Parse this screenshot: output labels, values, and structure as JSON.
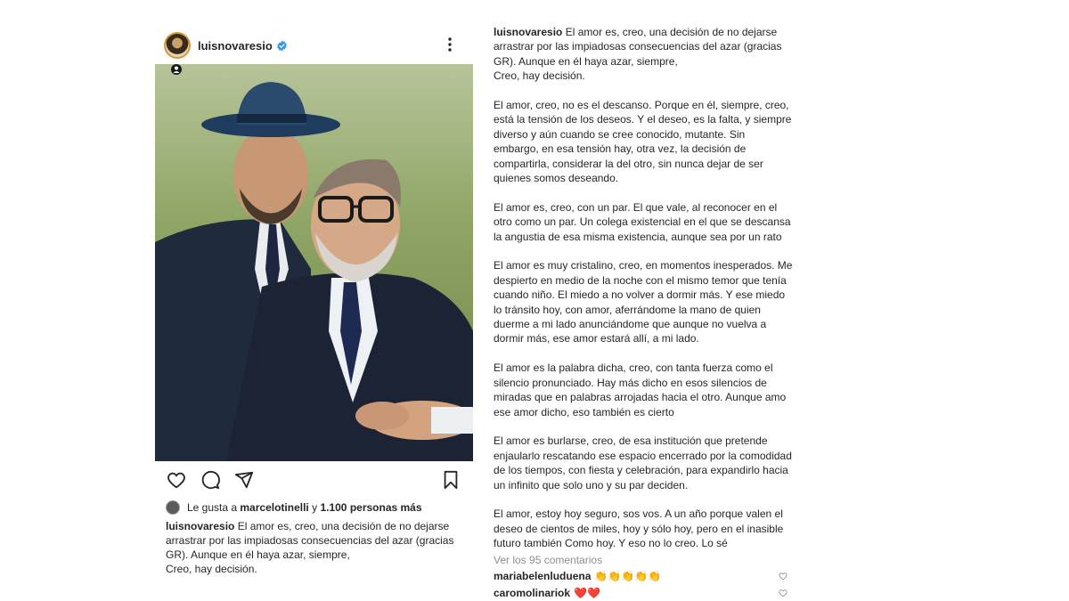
{
  "post": {
    "username": "luisnovaresio",
    "verified": true,
    "likes": {
      "prefix": "Le gusta a",
      "liker": "marcelotinelli",
      "joiner": "y",
      "others": "1.100 personas más"
    },
    "caption_username": "luisnovaresio",
    "caption_lines": [
      "El amor es, creo, una decisión de no dejarse",
      "arrastrar por las impiadosas consecuencias del azar (gracias",
      "GR). Aunque en él haya azar, siempre,",
      "Creo, hay decisión."
    ]
  },
  "caption_panel": {
    "username": "luisnovaresio",
    "first_paragraph": [
      "El amor es, creo, una decisión de no dejarse",
      "arrastrar por las impiadosas consecuencias del azar (gracias",
      "GR). Aunque en él haya azar, siempre,",
      "Creo, hay decisión."
    ],
    "paragraphs": [
      "El amor, creo,  no es el descanso. Porque en él, siempre, creo, está la tensión  de los deseos. Y el deseo, es la falta, y siempre diverso y aún cuando se cree conocido, mutante. Sin embargo, en esa tensión hay, otra vez, la decisión de compartirla, considerar la del otro, sin nunca dejar de ser quienes somos deseando.",
      "El amor es, creo,  con un par. El que vale, al reconocer en el otro como un par. Un colega existencial en el que se descansa la angustia de esa misma existencia, aunque sea por un rato",
      "El amor es muy cristalino, creo, en momentos inesperados. Me despierto en medio de la noche con el mismo temor que tenía cuando niño. El miedo a no volver a dormir más. Y ese miedo lo tránsito hoy, con amor, aferrándome la mano de quien duerme a mi lado anunciándome que aunque no vuelva a dormir más, ese amor estará allí, a mi lado.",
      "El amor es la palabra dicha, creo, con tanta fuerza como el silencio pronunciado. Hay más dicho en esos silencios de miradas que en palabras arrojadas hacia el otro. Aunque amo ese amor dicho, eso también es cierto",
      "El amor es burlarse, creo,  de esa institución que pretende enjaularlo rescatando ese espacio encerrado por la comodidad de los tiempos, con fiesta y celebración,  para expandirlo hacia un infinito que solo uno y su par deciden.",
      "El amor, estoy hoy seguro, sos vos.  A un año porque valen el deseo de cientos de miles, hoy y sólo hoy, pero en el inasible futuro también  Como hoy. Y eso no lo creo.  Lo sé"
    ],
    "view_comments": "Ver los 95 comentarios",
    "comments": [
      {
        "user": "mariabelenluduena",
        "text": "👏👏👏👏👏"
      },
      {
        "user": "caromolinariok",
        "text": "❤️❤️"
      }
    ]
  },
  "icons": {
    "more": "more-dots-icon",
    "like": "heart-icon",
    "comment": "comment-icon",
    "share": "share-icon",
    "save": "bookmark-icon",
    "verified": "verified-badge-icon",
    "tag": "user-tag-icon"
  },
  "colors": {
    "verified_blue": "#3897f0",
    "text": "#262626",
    "muted": "#8e8e8e",
    "avatar_ring": "#d89a3c"
  }
}
